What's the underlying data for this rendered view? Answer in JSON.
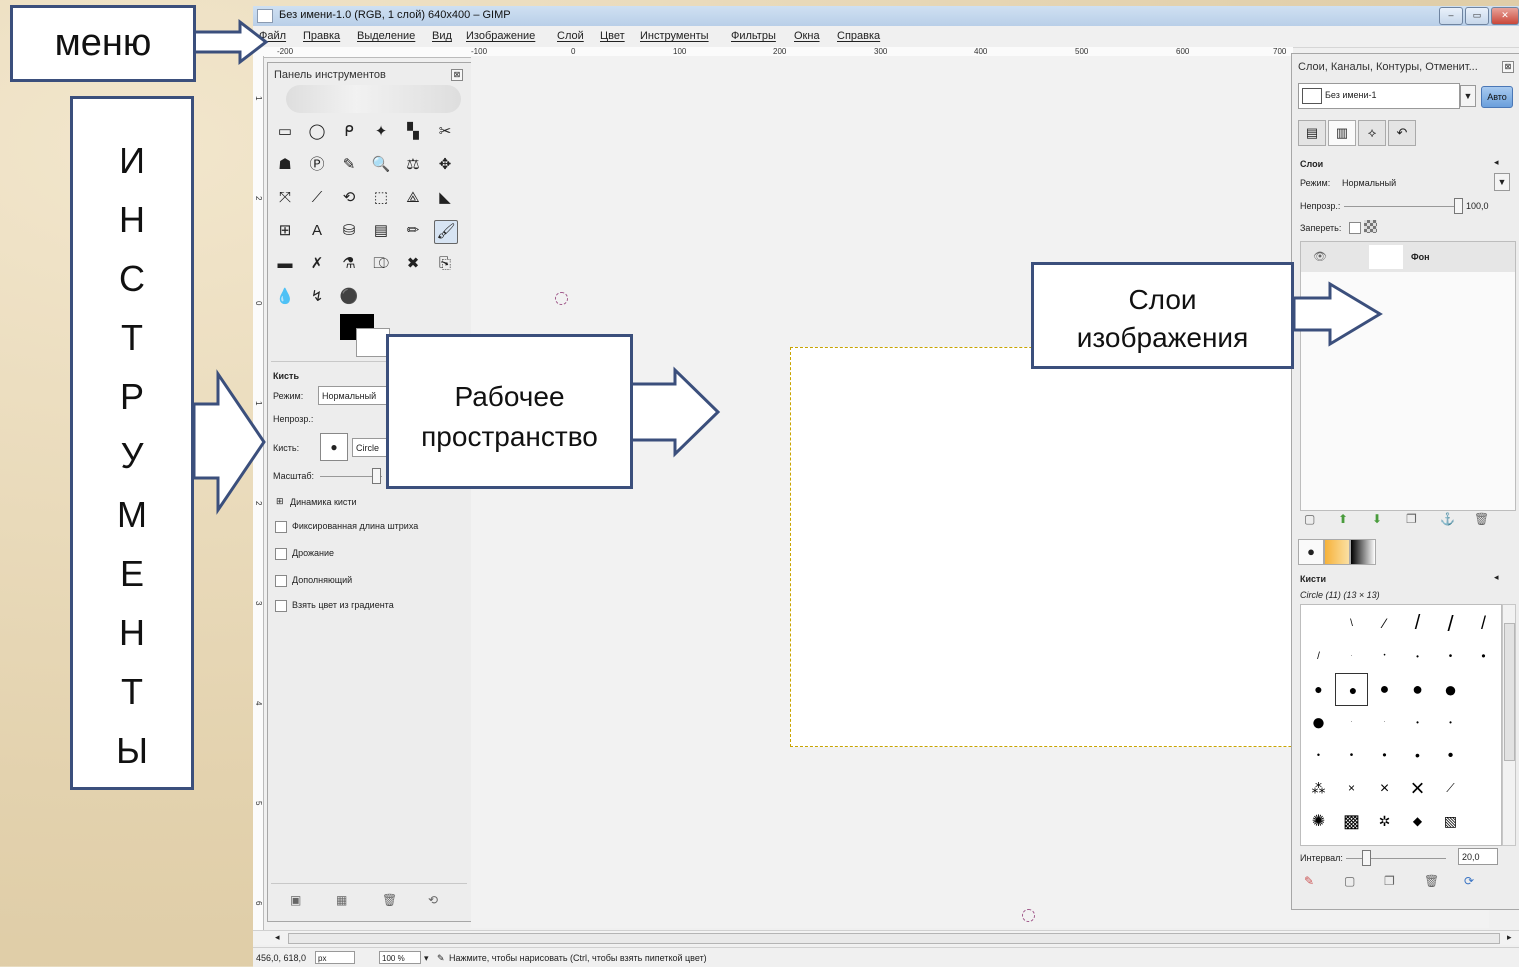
{
  "window": {
    "title": "Без имени-1.0 (RGB, 1 слой) 640x400 – GIMP",
    "buttons": [
      "–",
      "▭",
      "✕"
    ]
  },
  "menu": [
    "Файл",
    "Правка",
    "Выделение",
    "Вид",
    "Изображение",
    "Слой",
    "Цвет",
    "Инструменты",
    "Фильтры",
    "Окна",
    "Справка"
  ],
  "ruler": {
    "h": [
      "-100",
      "0",
      "100",
      "200",
      "300",
      "400",
      "500",
      "600",
      "700"
    ],
    "left_label": "-200"
  },
  "vruler": [
    "1",
    "2",
    "3",
    "0",
    "1",
    "0",
    "2",
    "0",
    "3",
    "0",
    "4",
    "0",
    "5",
    "0",
    "6"
  ],
  "toolbox": {
    "title": "Панель инструментов",
    "tools": [
      [
        "▭",
        "◯",
        "ᑭ",
        "✦",
        "▚",
        "✂"
      ],
      [
        "☗",
        "Ⓟ",
        "✎",
        "🔍",
        "⚖",
        "✥"
      ],
      [
        "⤧",
        "⟋",
        "⟲",
        "⬚",
        "⟁",
        "◣"
      ],
      [
        "⊞",
        "A",
        "⛁",
        "▤",
        "✏",
        "🖌"
      ],
      [
        "▬",
        "✗",
        "⚗",
        "⎄",
        "✖",
        "⎘"
      ],
      [
        "💧",
        "↯",
        "⚫"
      ]
    ],
    "options_title": "Кисть",
    "mode_label": "Режим:",
    "mode_value": "Нормальный",
    "opacity_label": "Непрозр.:",
    "brush_label": "Кисть:",
    "brush_value": "Circle",
    "scale_label": "Масштаб:",
    "dynamics": "Динамика кисти",
    "fixed_stroke": "Фиксированная длина штриха",
    "jitter": "Дрожание",
    "incremental": "Дополняющий",
    "use_gradient": "Взять цвет из градиента"
  },
  "dock": {
    "title": "Слои, Каналы, Контуры, Отменит...",
    "image_name": "Без имени-1",
    "auto_label": "Авто",
    "section": "Слои",
    "mode_label": "Режим:",
    "mode_value": "Нормальный",
    "opacity_label": "Непрозр.:",
    "opacity_value": "100,0",
    "lock_label": "Запереть:",
    "layer_name": "Фон",
    "brushes_title": "Кисти",
    "brush_info": "Circle (11) (13 × 13)",
    "interval_label": "Интервал:",
    "interval_value": "20,0"
  },
  "status": {
    "coords": "456,0, 618,0",
    "unit": "px",
    "zoom": "100 %",
    "message": "Нажмите, чтобы нарисовать (Ctrl, чтобы взять пипеткой цвет)"
  },
  "annotations": {
    "menu": "меню",
    "tools_letters": [
      "И",
      "Н",
      "С",
      "Т",
      "Р",
      "У",
      "М",
      "Е",
      "Н",
      "Т",
      "Ы"
    ],
    "workspace_line1": "Рабочее",
    "workspace_line2": "пространство",
    "layers_line1": "Слои",
    "layers_line2": "изображения"
  },
  "colors": {
    "callout_border": "#3b4f7c",
    "selection_dash": "#c9a400"
  }
}
